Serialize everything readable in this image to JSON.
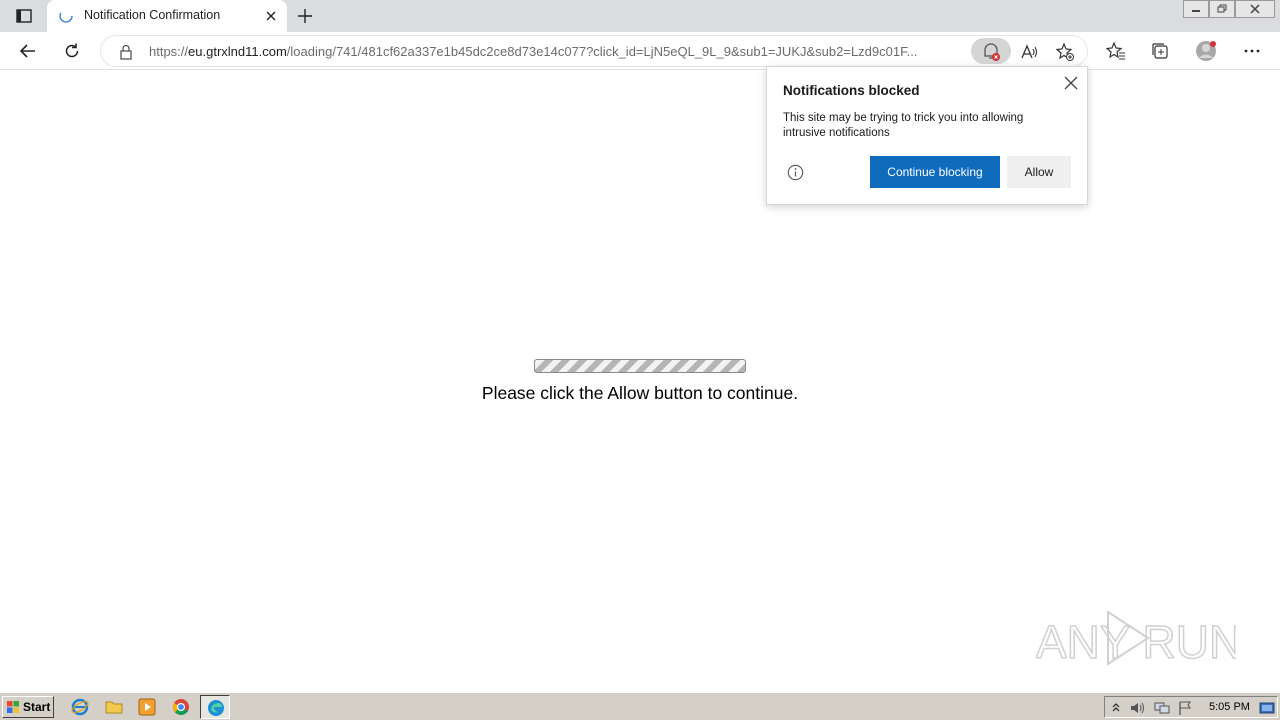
{
  "browser": {
    "tab_title": "Notification Confirmation",
    "address": {
      "scheme": "https://",
      "host": "eu.gtrxlnd11.com",
      "path": "/loading/741/481cf62a337e1b45dc2ce8d73e14c077?click_id=LjN5eQL_9L_9&sub1=JUKJ&sub2=Lzd9c01F..."
    }
  },
  "popup": {
    "title": "Notifications blocked",
    "body": "This site may be trying to trick you into allowing intrusive notifications",
    "continue_label": "Continue blocking",
    "allow_label": "Allow"
  },
  "page": {
    "message": "Please click the Allow button to continue."
  },
  "watermark": "ANY RUN",
  "taskbar": {
    "start_label": "Start",
    "clock": "5:05 PM"
  },
  "colors": {
    "accent": "#0f6cbd",
    "notif_badge": "#d13438"
  }
}
